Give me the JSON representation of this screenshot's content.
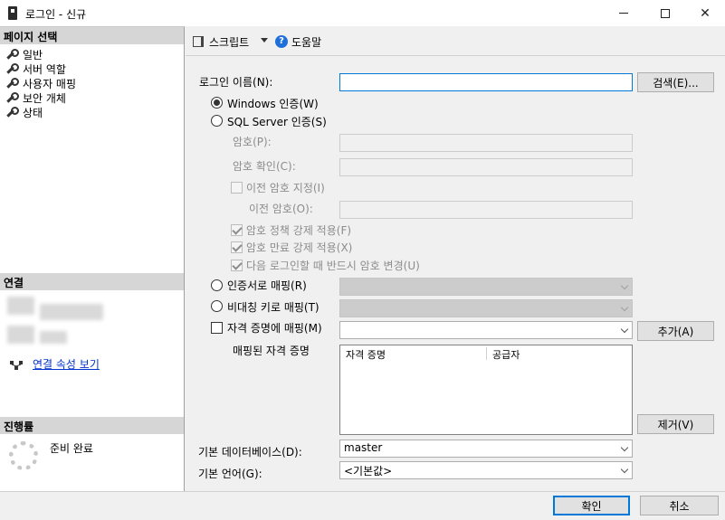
{
  "window": {
    "title": "로그인 - 신규"
  },
  "left": {
    "page_select_header": "페이지 선택",
    "nav_items": [
      "일반",
      "서버 역할",
      "사용자 매핑",
      "보안 개체",
      "상태"
    ],
    "connection_header": "연결",
    "connection_link": "연결 속성 보기",
    "progress_header": "진행률",
    "progress_status": "준비 완료"
  },
  "toolbar": {
    "script_label": "스크립트",
    "help_label": "도움말"
  },
  "form": {
    "login_name_label": "로그인 이름(N):",
    "login_name_value": "",
    "search_button": "검색(E)...",
    "windows_auth_label": "Windows 인증(W)",
    "sql_auth_label": "SQL Server 인증(S)",
    "password_label": "암호(P):",
    "confirm_password_label": "암호 확인(C):",
    "old_password_check_label": "이전 암호 지정(I)",
    "old_password_label": "이전 암호(O):",
    "enforce_policy_label": "암호 정책 강제 적용(F)",
    "enforce_expiration_label": "암호 만료 강제 적용(X)",
    "must_change_label": "다음 로그인할 때 반드시 암호 변경(U)",
    "cert_map_label": "인증서로 매핑(R)",
    "asym_key_map_label": "비대칭 키로 매핑(T)",
    "credential_map_label": "자격 증명에 매핑(M)",
    "add_button": "추가(A)",
    "mapped_credentials_label": "매핑된 자격 증명",
    "grid_columns": [
      "자격 증명",
      "공급자"
    ],
    "remove_button": "제거(V)",
    "default_db_label": "기본 데이터베이스(D):",
    "default_db_value": "master",
    "default_lang_label": "기본 언어(G):",
    "default_lang_value": "<기본값>"
  },
  "footer": {
    "ok_button": "확인",
    "cancel_button": "취소"
  }
}
